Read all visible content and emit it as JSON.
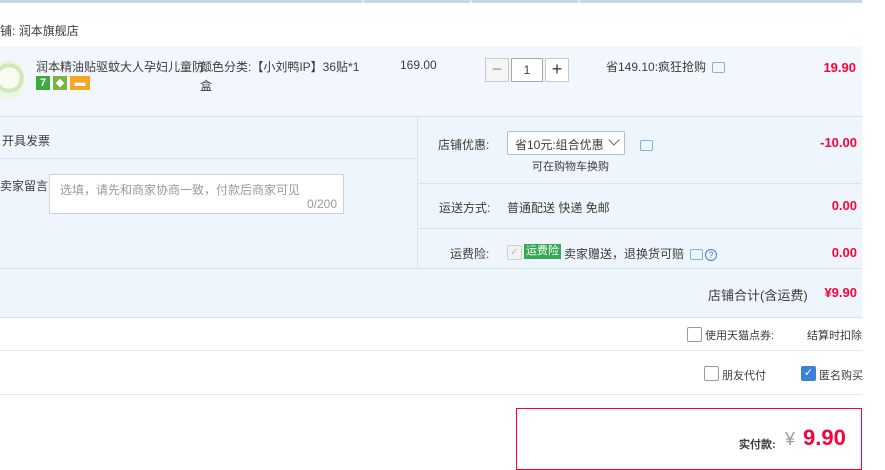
{
  "shop": {
    "label": "铺:",
    "name": "润本旗舰店"
  },
  "item": {
    "title": "润本精油贴驱蚊大人孕妇儿童防...",
    "badge_number": "7",
    "sku_label": "颜色分类:",
    "sku_value": "【小刘鸭IP】36贴*1盒",
    "unit_price": "169.00",
    "quantity": "1",
    "minus": "−",
    "plus": "+",
    "promo": "省149.10:疯狂抢购",
    "subtotal": "19.90"
  },
  "invoice": {
    "label": "开具发票"
  },
  "seller_message": {
    "label": "卖家留言:",
    "placeholder": "选填，请先和商家协商一致，付款后商家可见",
    "count": "0/200"
  },
  "store_discount": {
    "label": "店铺优惠:",
    "selected": "省10元:组合优惠",
    "note": "可在购物车换购",
    "amount": "-10.00"
  },
  "shipping": {
    "label": "运送方式:",
    "value": "普通配送 快递 免邮",
    "amount": "0.00"
  },
  "freight_insurance": {
    "label": "运费险:",
    "tag": "运费险",
    "desc": "卖家赠送，退换货可赔",
    "help": "?",
    "amount": "0.00"
  },
  "store_total": {
    "label": "店铺合计(含运费)",
    "amount": "¥9.90"
  },
  "coupon": {
    "label": "使用天猫点券:",
    "note": "结算时扣除"
  },
  "options": {
    "friend_pay": "朋友代付",
    "anonymous": "匿名购买"
  },
  "payment": {
    "label": "实付款:",
    "currency": "¥",
    "amount": "9.90"
  },
  "colors": {
    "accent_red": "#ff0036",
    "panel_blue": "#eef5fc",
    "check_blue": "#3b82d6"
  }
}
